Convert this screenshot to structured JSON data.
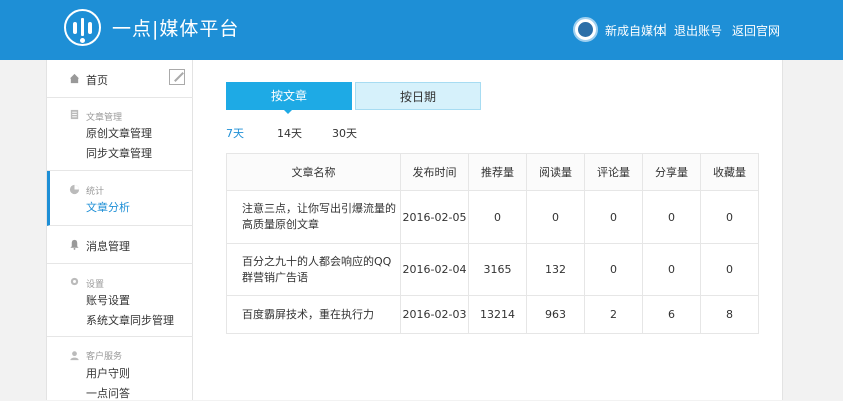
{
  "header": {
    "brand": "一点|媒体平台",
    "user_name": "新成自媒体",
    "separator": "|",
    "logout": "退出账号",
    "home": "返回官网"
  },
  "sidebar": {
    "home": "首页",
    "article_group": {
      "title": "文章管理",
      "items": [
        "原创文章管理",
        "同步文章管理"
      ]
    },
    "stats_group": {
      "title": "统计",
      "items": [
        "文章分析"
      ]
    },
    "message": "消息管理",
    "settings_group": {
      "title": "设置",
      "items": [
        "账号设置",
        "系统文章同步管理"
      ]
    },
    "service_group": {
      "title": "客户服务",
      "items": [
        "用户守则",
        "一点问答"
      ]
    }
  },
  "tabs": {
    "by_article": "按文章",
    "by_date": "按日期"
  },
  "periods": [
    "7天",
    "14天",
    "30天"
  ],
  "table": {
    "headers": [
      "文章名称",
      "发布时间",
      "推荐量",
      "阅读量",
      "评论量",
      "分享量",
      "收藏量"
    ],
    "rows": [
      {
        "title_line1": "注意三点，让你写出引爆流量的",
        "title_line2": "高质量原创文章",
        "date": "2016-02-05",
        "rec": "0",
        "read": "0",
        "comment": "0",
        "share": "0",
        "fav": "0"
      },
      {
        "title_line1": "百分之九十的人都会响应的QQ",
        "title_line2": "群营销广告语",
        "date": "2016-02-04",
        "rec": "3165",
        "read": "132",
        "comment": "0",
        "share": "0",
        "fav": "0"
      },
      {
        "title_line1": "百度霸屏技术，重在执行力",
        "title_line2": "",
        "date": "2016-02-03",
        "rec": "13214",
        "read": "963",
        "comment": "2",
        "share": "6",
        "fav": "8"
      }
    ]
  }
}
